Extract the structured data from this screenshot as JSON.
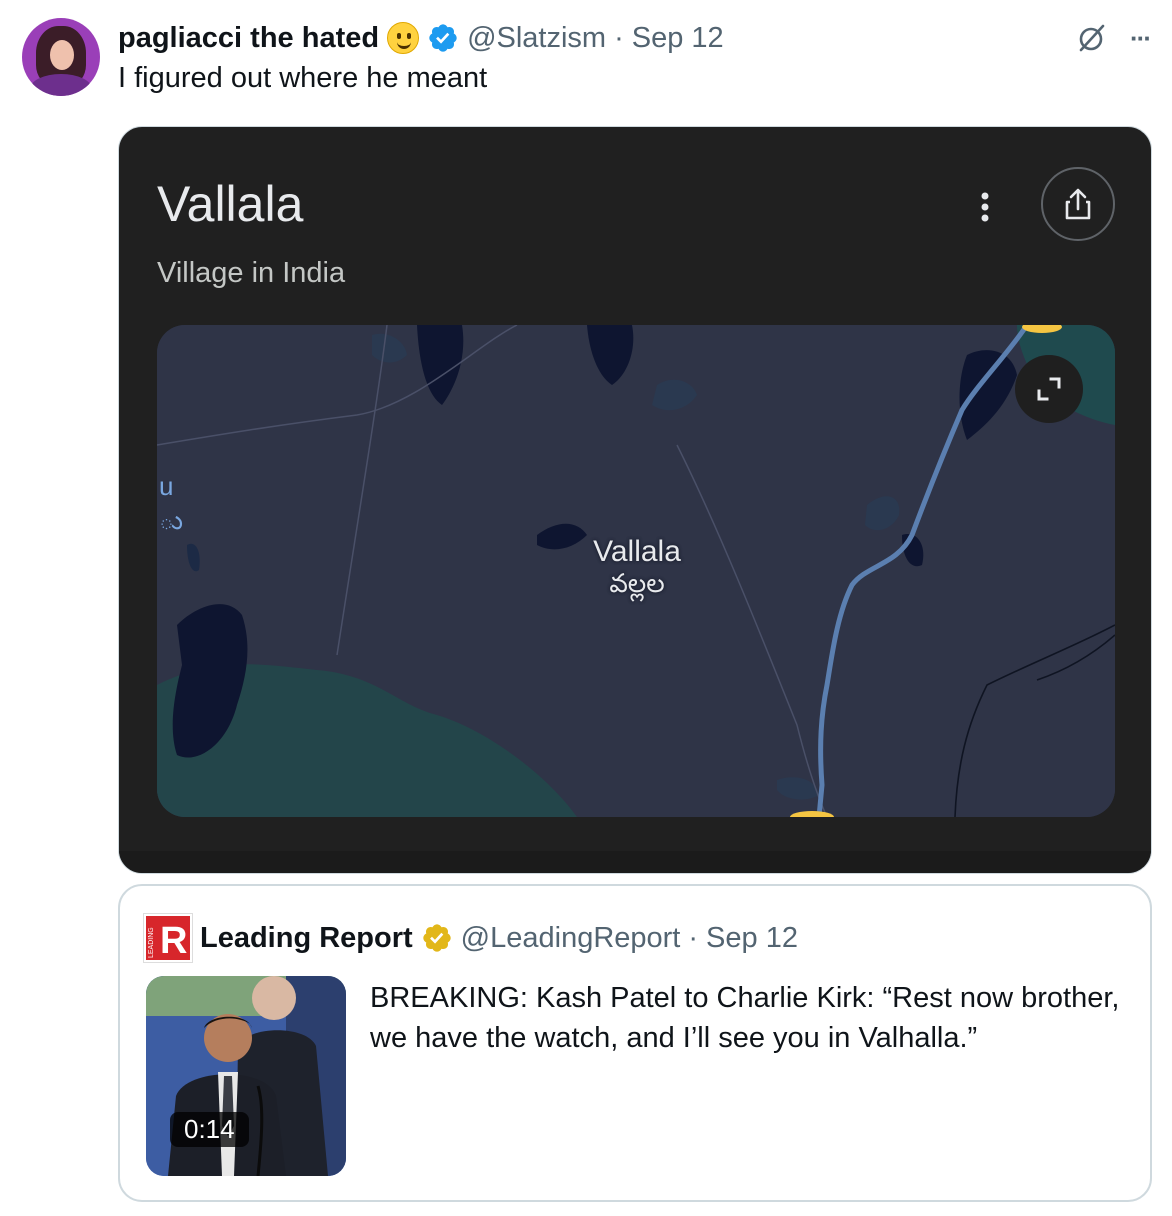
{
  "tweet": {
    "display_name": "pagliacci the hated",
    "handle": "@Slatzism",
    "separator": "·",
    "date": "Sep 12",
    "text": "I figured out where he meant",
    "emoji_icon": "slightly-smiling-face-icon",
    "verified_color": "#1d9bf0"
  },
  "map_card": {
    "title": "Vallala",
    "subtitle": "Village in India",
    "place_label_en": "Vallala",
    "place_label_te": "వల్లల",
    "edge_label_1": "u",
    "edge_label_2": "ు",
    "background": "#202020",
    "map_background": "#2f3447",
    "road_color": "#5b7fb0",
    "water_color": "#0e1530",
    "forest_color": "#1f4a4e"
  },
  "quote": {
    "logo_letter": "R",
    "logo_side_text": "LEADING",
    "display_name": "Leading Report",
    "handle": "@LeadingReport",
    "separator": "·",
    "date": "Sep 12",
    "text": "BREAKING: Kash Patel to Charlie Kirk: “Rest now brother, we have the watch, and I’ll see you in Valhalla.”",
    "video_duration": "0:14",
    "gold_check_color": "#e2b719",
    "logo_color": "#d7262b"
  },
  "actions": {
    "more_label": "···"
  }
}
